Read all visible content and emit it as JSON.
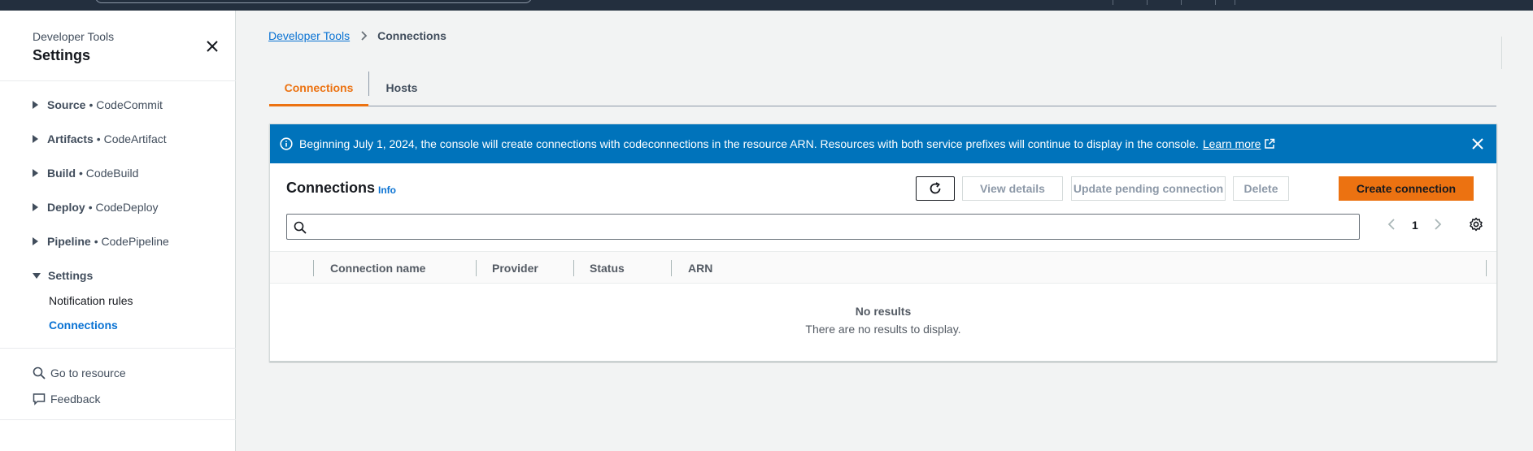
{
  "sidebar": {
    "subtitle": "Developer Tools",
    "title": "Settings",
    "items": [
      {
        "label": "Source",
        "service": "• CodeCommit"
      },
      {
        "label": "Artifacts",
        "service": "• CodeArtifact"
      },
      {
        "label": "Build",
        "service": "• CodeBuild"
      },
      {
        "label": "Deploy",
        "service": "• CodeDeploy"
      },
      {
        "label": "Pipeline",
        "service": "• CodePipeline"
      },
      {
        "label": "Settings",
        "service": ""
      }
    ],
    "settings_children": [
      "Notification rules",
      "Connections"
    ],
    "go_to_resource": "Go to resource",
    "feedback": "Feedback"
  },
  "breadcrumb": {
    "root": "Developer Tools",
    "current": "Connections"
  },
  "tabs": [
    "Connections",
    "Hosts"
  ],
  "banner": {
    "message": "Beginning July 1, 2024, the console will create connections with codeconnections in the resource ARN. Resources with both service prefixes will continue to display in the console.",
    "link": "Learn more"
  },
  "panel": {
    "title": "Connections",
    "info": "Info",
    "buttons": {
      "view_details": "View details",
      "update_pending": "Update pending connection",
      "delete": "Delete",
      "create": "Create connection"
    },
    "search_placeholder": "",
    "page": "1",
    "columns": [
      "Connection name",
      "Provider",
      "Status",
      "ARN"
    ],
    "empty_title": "No results",
    "empty_sub": "There are no results to display."
  },
  "colors": {
    "accent": "#ec7211",
    "link": "#0972d3",
    "banner": "#0073bb",
    "topbar": "#232f3e"
  }
}
